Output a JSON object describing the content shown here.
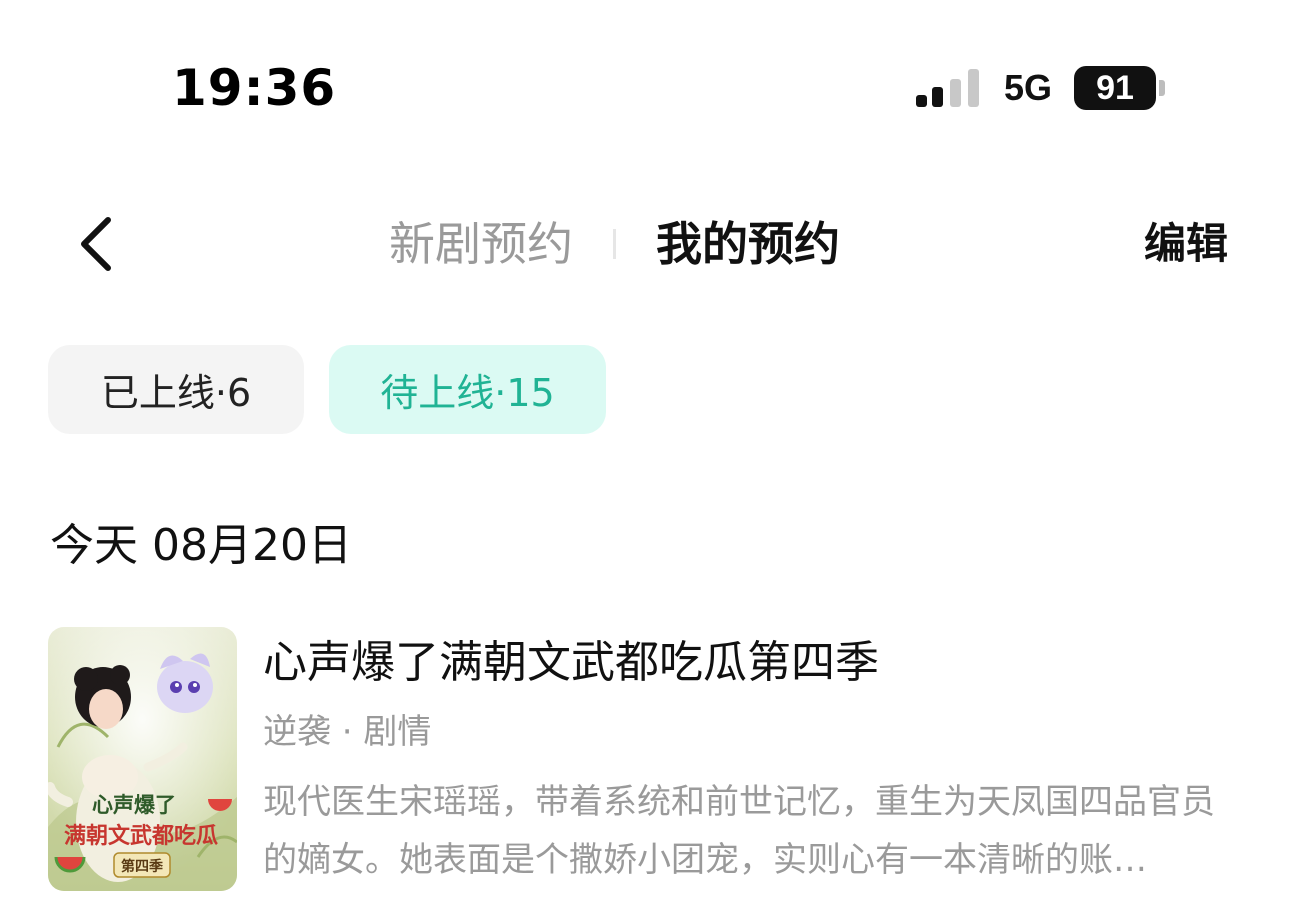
{
  "status_bar": {
    "time": "19:36",
    "network": "5G",
    "battery": "91"
  },
  "nav": {
    "tabs": [
      {
        "label": "新剧预约",
        "active": false
      },
      {
        "label": "我的预约",
        "active": true
      }
    ],
    "edit_label": "编辑"
  },
  "filters": [
    {
      "label": "已上线·6",
      "selected": false
    },
    {
      "label": "待上线·15",
      "selected": true
    }
  ],
  "sections": [
    {
      "date_label": "今天 08月20日",
      "items": [
        {
          "title": "心声爆了满朝文武都吃瓜第四季",
          "tags": "逆袭 · 剧情",
          "description": "现代医生宋瑶瑶，带着系统和前世记忆，重生为天凤国四品官员的嫡女。她表面是个撒娇小团宠，实则心有一本清晰的账…",
          "cover_text": {
            "title_line1": "心声爆了",
            "title_line2": "满朝文武都吃瓜",
            "season": "第四季"
          }
        }
      ]
    }
  ],
  "colors": {
    "accent": "#20b394",
    "accent_bg": "#dbfaf3",
    "muted_text": "#9a9a9a",
    "pill_bg": "#f4f4f4"
  }
}
